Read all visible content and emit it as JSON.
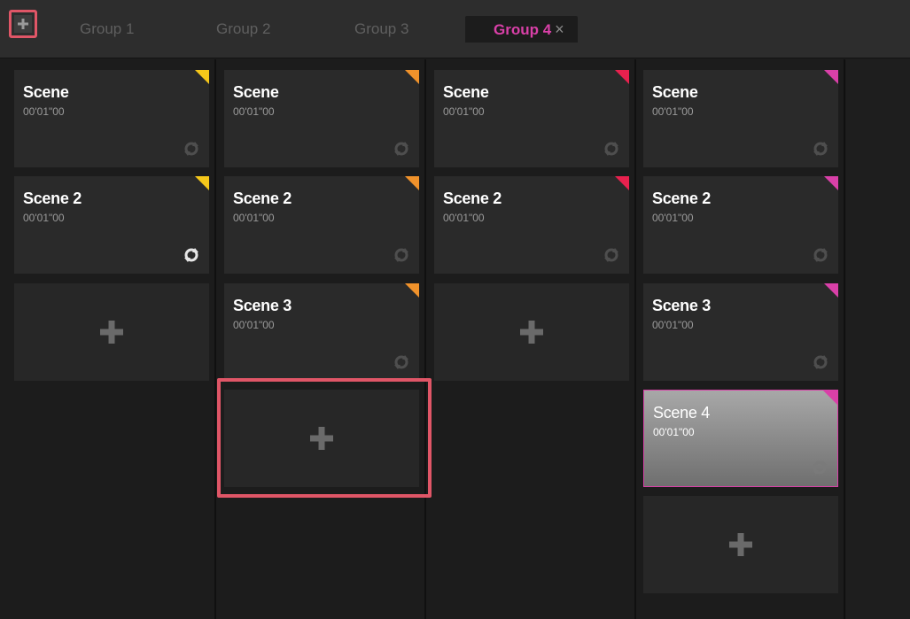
{
  "tabs": {
    "group1": "Group 1",
    "group2": "Group 2",
    "group3": "Group 3",
    "group4": "Group 4",
    "close": "×"
  },
  "columns": [
    {
      "accent": "#f5c71a",
      "scenes": [
        {
          "name": "Scene",
          "time": "00'01\"00"
        },
        {
          "name": "Scene 2",
          "time": "00'01\"00"
        }
      ]
    },
    {
      "accent": "#f0922b",
      "scenes": [
        {
          "name": "Scene",
          "time": "00'01\"00"
        },
        {
          "name": "Scene 2",
          "time": "00'01\"00"
        },
        {
          "name": "Scene 3",
          "time": "00'01\"00"
        }
      ]
    },
    {
      "accent": "#e8214e",
      "scenes": [
        {
          "name": "Scene",
          "time": "00'01\"00"
        },
        {
          "name": "Scene 2",
          "time": "00'01\"00"
        }
      ]
    },
    {
      "accent": "#d940a8",
      "scenes": [
        {
          "name": "Scene",
          "time": "00'01\"00"
        },
        {
          "name": "Scene 2",
          "time": "00'01\"00"
        },
        {
          "name": "Scene 3",
          "time": "00'01\"00"
        },
        {
          "name": "Scene 4",
          "time": "00'01\"00"
        }
      ]
    }
  ],
  "colors": {
    "active_tab": "#d940a8",
    "highlight": "#e05667"
  },
  "icons": {
    "add": "plus-icon",
    "loop": "loop-icon",
    "close": "close-icon"
  }
}
